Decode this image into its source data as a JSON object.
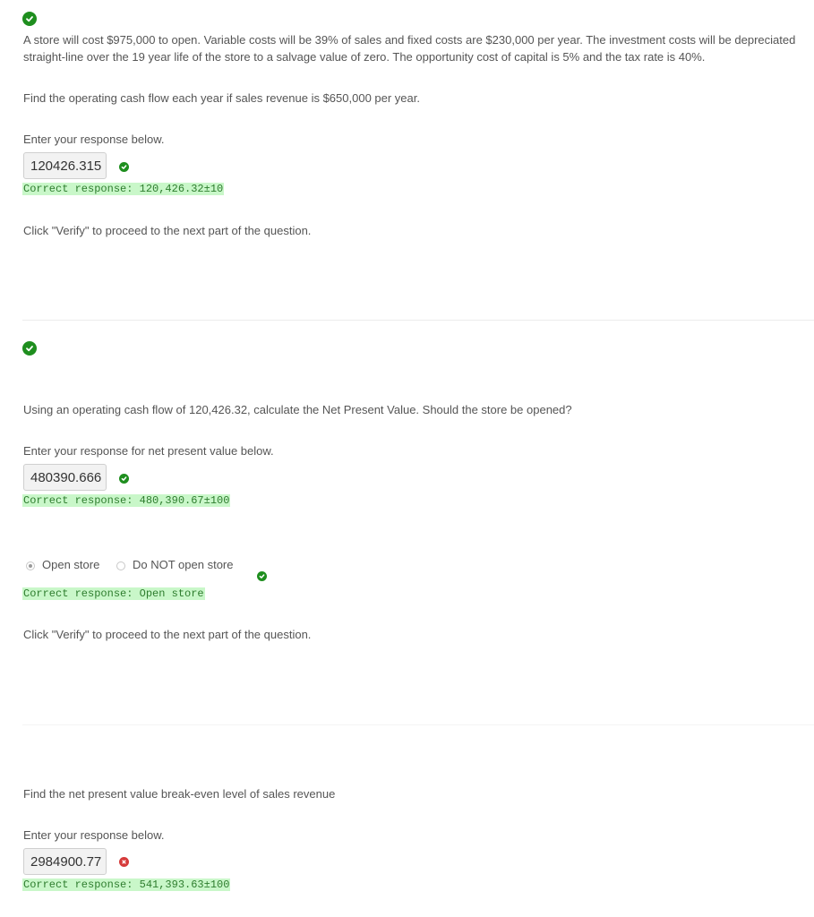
{
  "colors": {
    "correct": "#1e8e1e",
    "incorrect": "#d63b3b",
    "highlight": "#c9f7c9",
    "highlight_text": "#2e7d2e"
  },
  "icons": {
    "correct": "check-circle-icon",
    "incorrect": "x-circle-icon"
  },
  "part1": {
    "problem_text": "A store will cost $975,000 to open. Variable costs will be 39% of sales and fixed costs are $230,000 per year. The investment costs will be depreciated straight-line over the 19 year life of the store to a salvage value of zero. The opportunity cost of capital is 5% and the tax rate is 40%.",
    "question": "Find the operating cash flow each year if sales revenue is $650,000 per year.",
    "prompt": "Enter your response below.",
    "answer": "120426.315",
    "correct_response": "Correct response: 120,426.32±10",
    "verify_text": "Click \"Verify\" to proceed to the next part of the question."
  },
  "part2": {
    "question": "Using an operating cash flow of 120,426.32, calculate the Net Present Value. Should the store be opened?",
    "prompt": "Enter your response for net present value below.",
    "answer": "480390.666",
    "correct_response": "Correct response: 480,390.67±100",
    "radio_options": [
      "Open store",
      "Do NOT open store"
    ],
    "radio_selected": "Open store",
    "radio_correct_response": "Correct response: Open store",
    "verify_text": "Click \"Verify\" to proceed to the next part of the question."
  },
  "part3": {
    "question": "Find the net present value break-even level of sales revenue",
    "prompt": "Enter your response below.",
    "answer": "2984900.77",
    "correct_response": "Correct response: 541,393.63±100"
  }
}
